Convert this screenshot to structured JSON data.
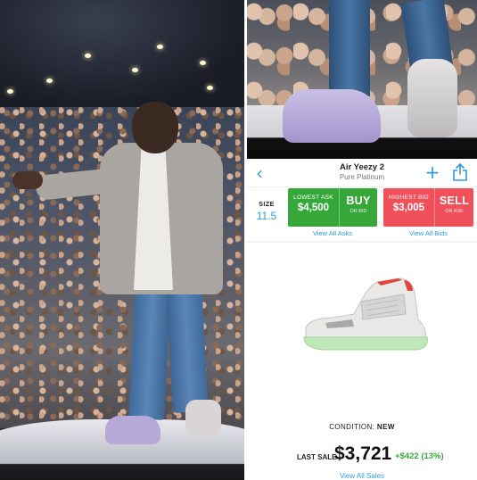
{
  "product": {
    "title": "Air Yeezy 2",
    "subtitle": "Pure Platinum"
  },
  "size": {
    "label": "SIZE",
    "value": "11.5"
  },
  "lowest_ask": {
    "caption": "LOWEST ASK",
    "price": "$4,500",
    "action": "BUY",
    "sub": "OR BID",
    "link": "View All Asks"
  },
  "highest_bid": {
    "caption": "HIGHEST BID",
    "price": "$3,005",
    "action": "SELL",
    "sub": "OR ASK",
    "link": "View All Bids"
  },
  "condition": {
    "label": "CONDITION:",
    "value": "NEW"
  },
  "last_sale": {
    "label": "LAST SALE",
    "value": "$3,721",
    "change": "+$422 (13%)",
    "link": "View All Sales"
  },
  "colors": {
    "accent": "#2e9be0",
    "buy": "#36a83a",
    "sell": "#f0505a",
    "positive": "#36a83a"
  },
  "icons": {
    "back": "chevron-left-icon",
    "add": "plus-icon",
    "share": "share-icon"
  }
}
